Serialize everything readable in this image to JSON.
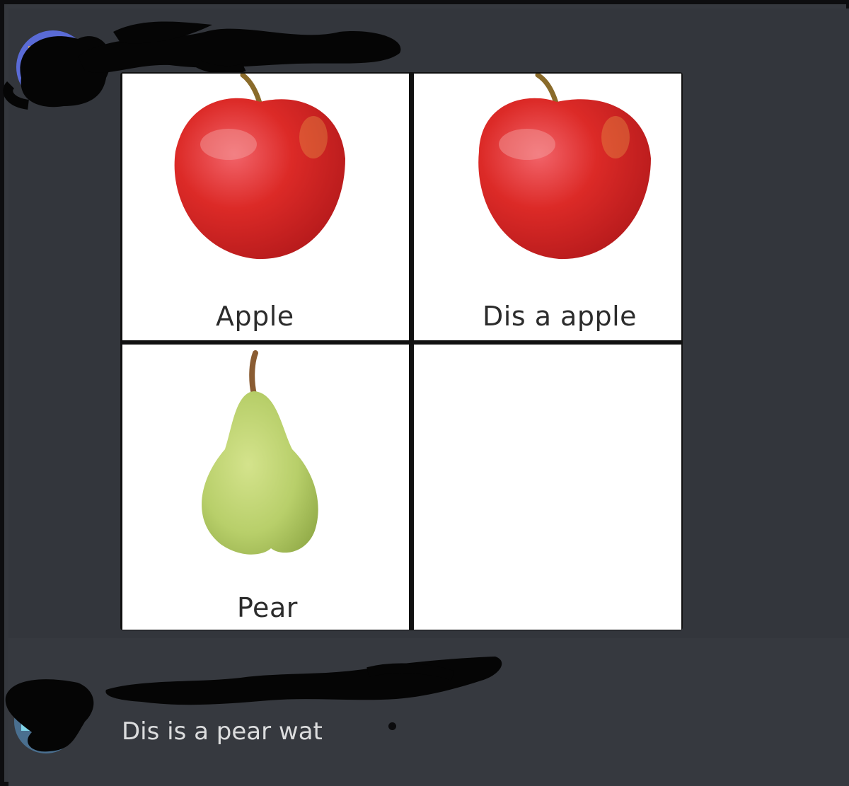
{
  "message_1": {
    "images": [
      {
        "label": "Apple",
        "fruit": "apple"
      },
      {
        "label": "Dis a apple",
        "fruit": "apple"
      },
      {
        "label": "Pear",
        "fruit": "pear"
      },
      {
        "label": "",
        "fruit": "none"
      }
    ]
  },
  "message_2": {
    "text": "Dis is a pear wat"
  },
  "colors": {
    "background": "#36393f",
    "message_text": "#dcddde",
    "apple_red": "#d42a24",
    "pear_green": "#b8cf6a"
  },
  "icons": [
    "avatar-icon",
    "apple-image",
    "pear-image"
  ]
}
